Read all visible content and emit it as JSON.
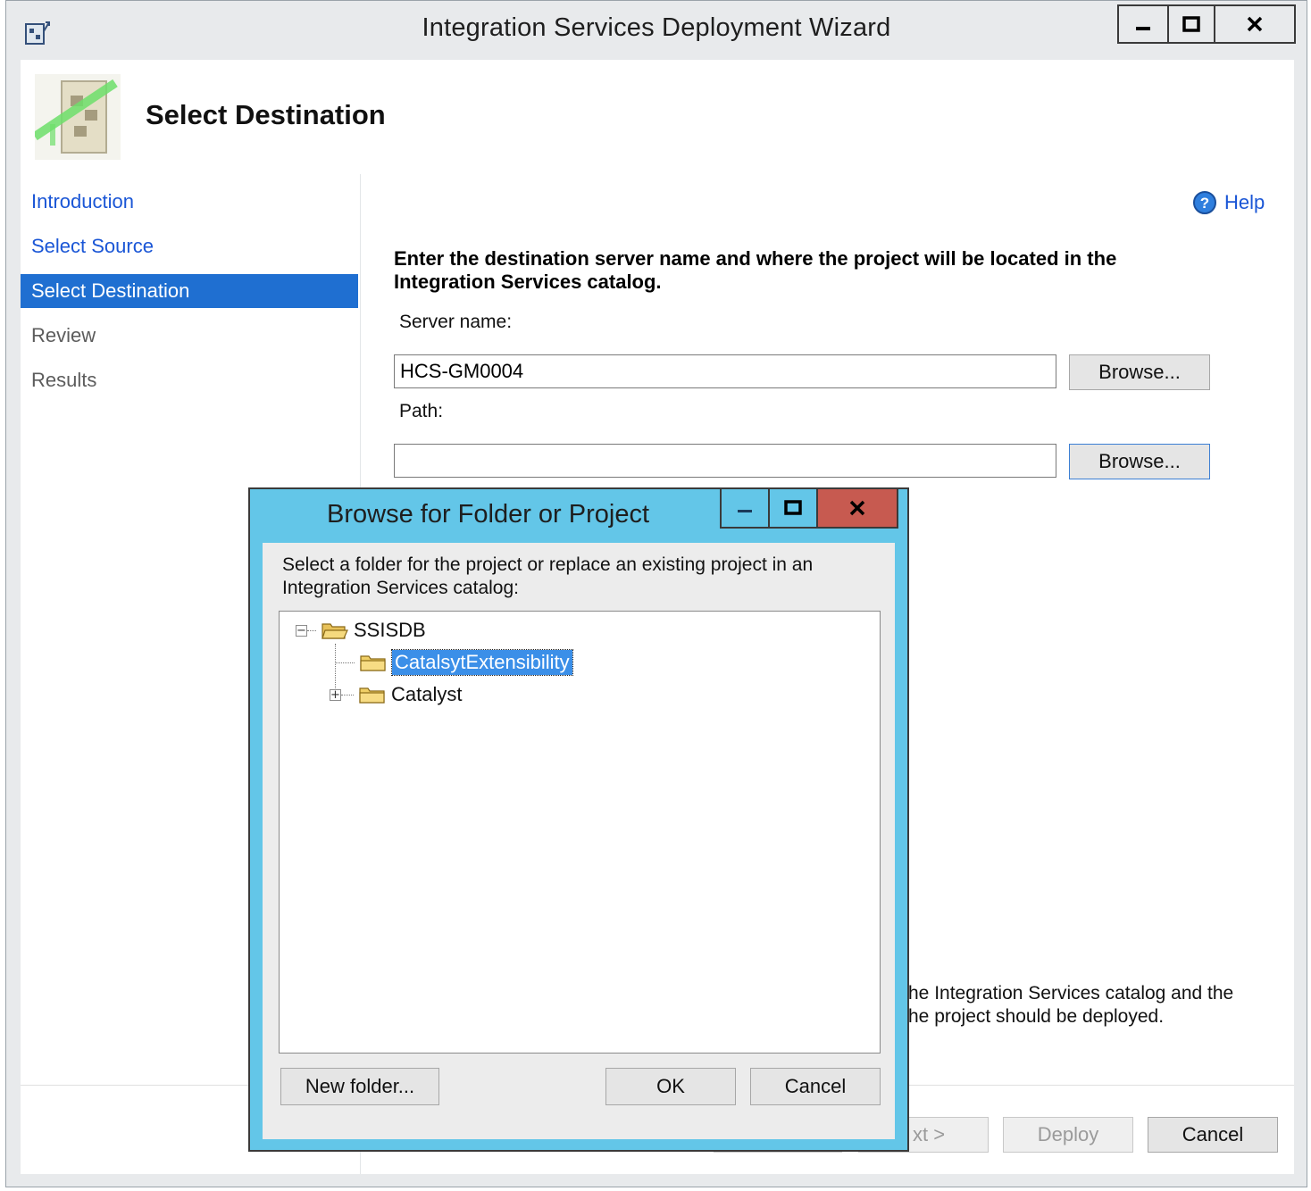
{
  "window": {
    "title": "Integration Services Deployment Wizard",
    "controls": {
      "minimize": "‒",
      "maximize": "□",
      "close": "✕"
    }
  },
  "header": {
    "title": "Select Destination"
  },
  "nav": {
    "items": [
      {
        "label": "Introduction",
        "state": "link"
      },
      {
        "label": "Select Source",
        "state": "link"
      },
      {
        "label": "Select Destination",
        "state": "selected"
      },
      {
        "label": "Review",
        "state": "disabled"
      },
      {
        "label": "Results",
        "state": "disabled"
      }
    ]
  },
  "content": {
    "help_label": "Help",
    "instruction": "Enter the destination server name and where the project will be located in the Integration Services catalog.",
    "server_label": "Server name:",
    "server_value": "HCS-GM0004",
    "browse_label": "Browse...",
    "path_label": "Path:",
    "path_value": "",
    "info_line1": "he Integration Services catalog and the",
    "info_line2": "he project should be deployed."
  },
  "footer": {
    "next_label": "xt >",
    "deploy_label": "Deploy",
    "cancel_label": "Cancel"
  },
  "dialog": {
    "title": "Browse for Folder or Project",
    "prompt": "Select a folder for the project or replace an existing project in an Integration Services catalog:",
    "tree": {
      "root": "SSISDB",
      "children": [
        {
          "label": "CatalsytExtensibility",
          "selected": true
        },
        {
          "label": "Catalyst",
          "selected": false
        }
      ]
    },
    "new_folder_label": "New folder...",
    "ok_label": "OK",
    "cancel_label": "Cancel"
  },
  "colors": {
    "accent": "#1f6fd1",
    "link": "#1a56d6",
    "dialog_frame": "#63c6e8",
    "close_button": "#c75a50"
  }
}
